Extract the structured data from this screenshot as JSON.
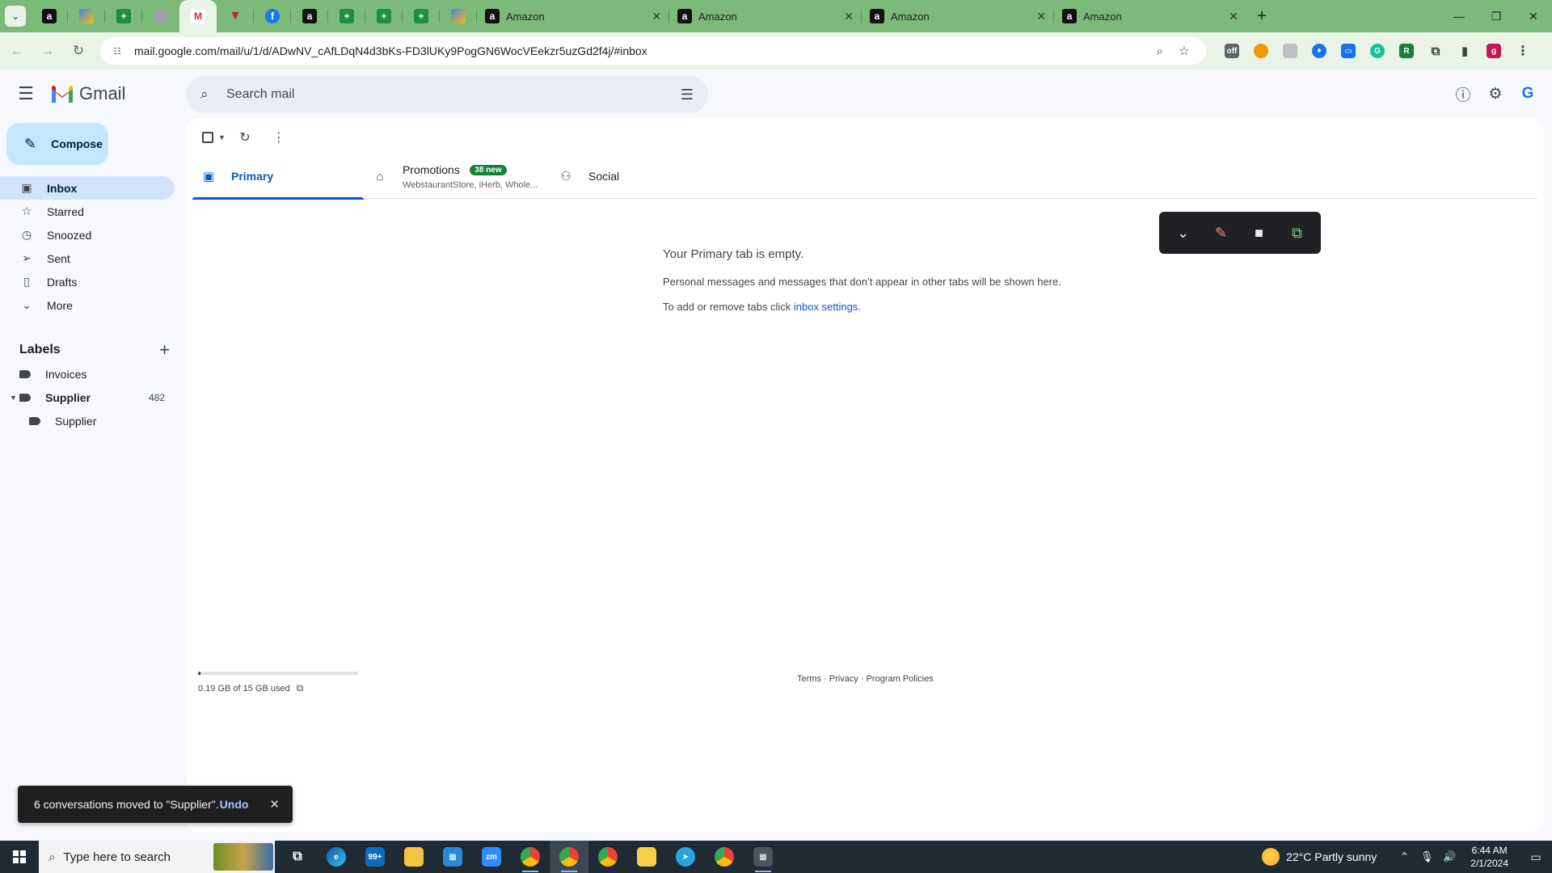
{
  "browser": {
    "tabs": [
      {
        "title": "Amazon"
      },
      {
        "title": "Amazon"
      },
      {
        "title": "Amazon"
      },
      {
        "title": "Amazon"
      }
    ],
    "url": "mail.google.com/mail/u/1/d/ADwNV_cAfLDqN4d3bKs-FD3lUKy9PogGN6WocVEekzr5uzGd2f4j/#inbox",
    "profile_initial": "g"
  },
  "gmail": {
    "logo_text": "Gmail",
    "search_placeholder": "Search mail",
    "compose_label": "Compose",
    "nav": [
      {
        "label": "Inbox"
      },
      {
        "label": "Starred"
      },
      {
        "label": "Snoozed"
      },
      {
        "label": "Sent"
      },
      {
        "label": "Drafts"
      },
      {
        "label": "More"
      }
    ],
    "labels_heading": "Labels",
    "labels": [
      {
        "label": "Invoices",
        "count": ""
      },
      {
        "label": "Supplier",
        "count": "482"
      },
      {
        "label": "Supplier",
        "count": ""
      }
    ],
    "tabs": [
      {
        "label": "Primary",
        "badge": "",
        "subtitle": ""
      },
      {
        "label": "Promotions",
        "badge": "38 new",
        "subtitle": "WebstaurantStore, iHerb, Whole..."
      },
      {
        "label": "Social",
        "badge": "",
        "subtitle": ""
      }
    ],
    "empty": {
      "title": "Your Primary tab is empty.",
      "line1": "Personal messages and messages that don’t appear in other tabs will be shown here.",
      "line2_prefix": "To add or remove tabs click ",
      "line2_link": "inbox settings",
      "line2_suffix": "."
    },
    "storage": {
      "text": "0.19 GB of 15 GB used",
      "used_fraction": 0.013
    },
    "footer": {
      "terms": "Terms",
      "privacy": "Privacy",
      "policies": "Program Policies",
      "sep": " · "
    },
    "snackbar": {
      "message": "6 conversations moved to \"Supplier\".",
      "action": "Undo"
    }
  },
  "taskbar": {
    "search_placeholder": "Type here to search",
    "weather": "22°C  Partly sunny",
    "time": "6:44 AM",
    "date": "2/1/2024",
    "mail_badge": "99+"
  },
  "colors": {
    "tabbar": "#7cba7a",
    "gmail_bg": "#f6f8fc",
    "accent": "#0b57d0",
    "compose": "#c2e7ff"
  }
}
